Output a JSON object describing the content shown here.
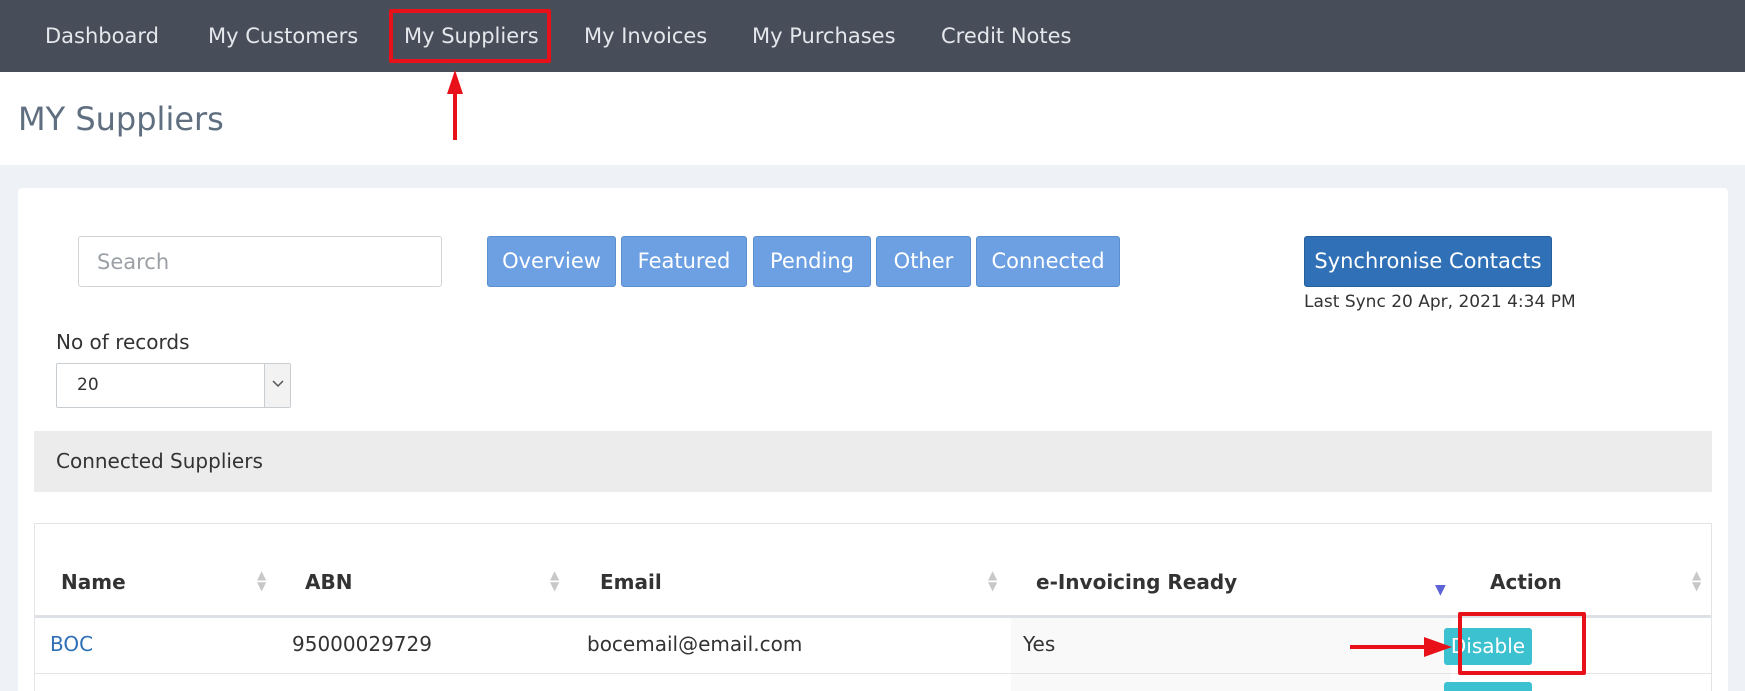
{
  "nav": {
    "items": [
      {
        "label": "Dashboard"
      },
      {
        "label": "My Customers"
      },
      {
        "label": "My Suppliers"
      },
      {
        "label": "My Invoices"
      },
      {
        "label": "My Purchases"
      },
      {
        "label": "Credit Notes"
      }
    ]
  },
  "page": {
    "title": "MY Suppliers"
  },
  "search": {
    "placeholder": "Search"
  },
  "filters": {
    "buttons": [
      {
        "label": "Overview"
      },
      {
        "label": "Featured"
      },
      {
        "label": "Pending"
      },
      {
        "label": "Other"
      },
      {
        "label": "Connected"
      }
    ]
  },
  "sync": {
    "label": "Synchronise Contacts",
    "last_sync": "Last Sync 20 Apr, 2021 4:34 PM"
  },
  "records": {
    "label": "No of records",
    "value": "20"
  },
  "section": {
    "title": "Connected Suppliers"
  },
  "table": {
    "columns": [
      "Name",
      "ABN",
      "Email",
      "e-Invoicing Ready",
      "Action"
    ],
    "rows": [
      {
        "name": "BOC",
        "abn": "95000029729",
        "email": "bocemail@email.com",
        "einvoicing": "Yes",
        "action": "Disable"
      }
    ]
  },
  "colors": {
    "nav_bg": "#474e59",
    "filter_button": "#6ca0e2",
    "primary_button": "#2f70b6",
    "action_button": "#3cc1d1",
    "annotation": "#e8111a"
  }
}
